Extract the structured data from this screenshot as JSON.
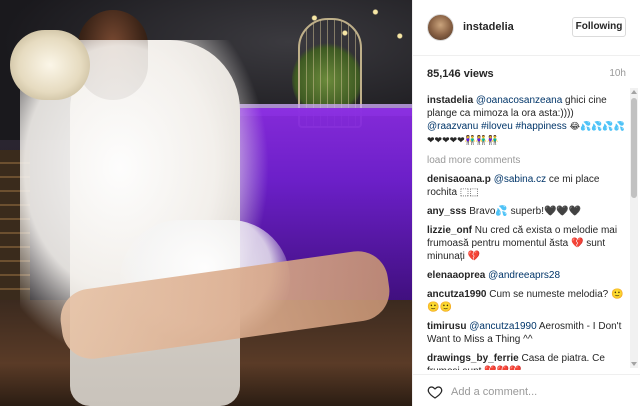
{
  "post": {
    "username": "instadelia",
    "follow_label": "Following",
    "views": "85,146 views",
    "time": "10h",
    "load_more": "load more comments",
    "add_comment_placeholder": "Add a comment..."
  },
  "caption": {
    "user": "instadelia",
    "mention1": "@oanacosanzeana",
    "text1": " ghici cine plange ca mimoza la ora asta:))))",
    "mention2": "@raazvanu",
    "tags": "#iloveu #happiness",
    "emojis": "😂💦💦💦💦❤❤❤❤❤👫👫👫"
  },
  "comments": [
    {
      "user": "denisaoana.p",
      "mention": "@sabina.cz",
      "text": " ce mi place rochita ⬚⬚"
    },
    {
      "user": "any_sss",
      "text": " Bravo💦 superb!🖤🖤🖤"
    },
    {
      "user": "lizzie_onf",
      "text": " Nu cred că exista o melodie mai frumoasă pentru momentul ăsta 💔 sunt minunați 💔"
    },
    {
      "user": "elenaaoprea",
      "mention": "@andreeaprs28",
      "text": ""
    },
    {
      "user": "ancutza1990",
      "text": " Cum se numeste melodia? 🙂🙂🙂"
    },
    {
      "user": "timirusu",
      "mention": "@ancutza1990",
      "text": " Aerosmith - I Don't Want to Miss a Thing ^^"
    },
    {
      "user": "drawings_by_ferrie",
      "text": " Casa de piatra. Ce frumosi sunt 💔💔💔"
    }
  ],
  "colors": {
    "link": "#003569",
    "muted": "#999999",
    "border": "#efefef",
    "stage_purple": "#8a2be2"
  },
  "icons": {
    "like": "heart-icon"
  }
}
